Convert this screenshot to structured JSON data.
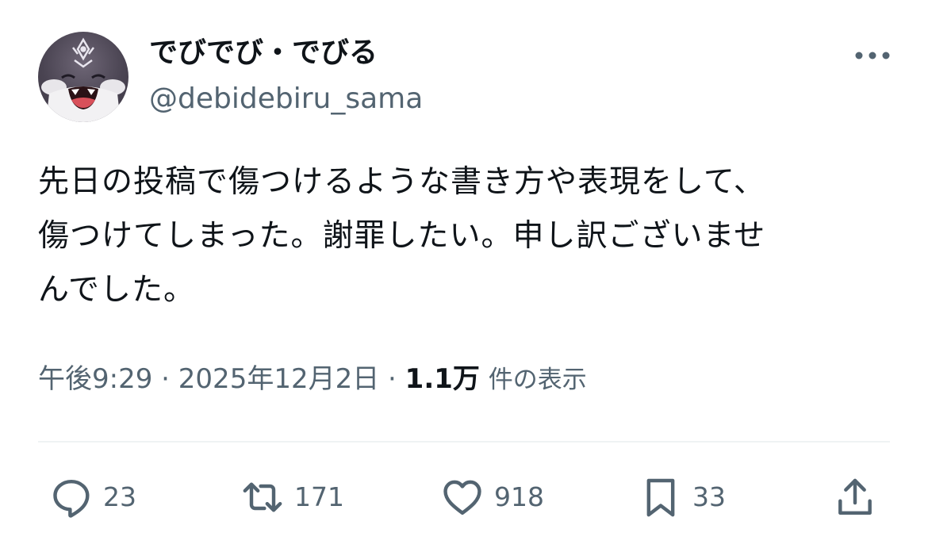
{
  "author": {
    "display_name": "でびでび・でびる",
    "handle": "@debidebiru_sama",
    "avatar_icon": "avatar-character-icon"
  },
  "tweet": {
    "lines": [
      "先日の投稿で傷つけるような書き方や表現をして、",
      "傷つけてしまった。謝罪したい。申し訳ございませ",
      "んでした。"
    ],
    "time": "午後9:29",
    "separator": " · ",
    "date": "2025年12月2日",
    "views": "1.1万",
    "views_label": "件の表示"
  },
  "actions": {
    "replies": "23",
    "retweets": "171",
    "likes": "918",
    "bookmarks": "33"
  },
  "colors": {
    "text": "#0f1419",
    "secondary": "#536471",
    "divider": "#eff3f4"
  }
}
